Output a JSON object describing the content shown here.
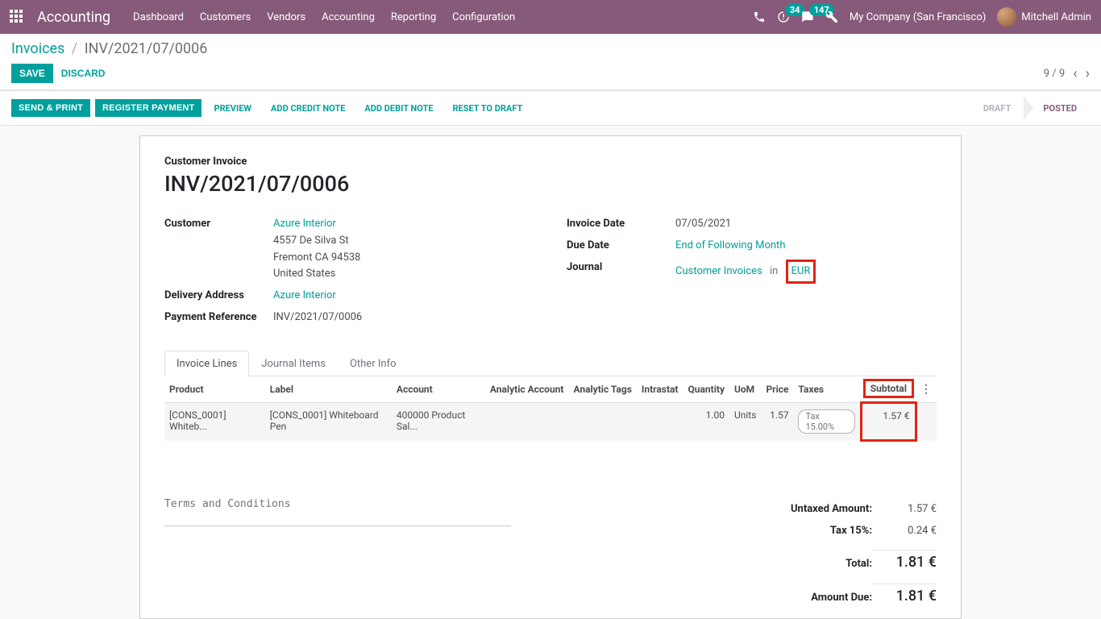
{
  "nav": {
    "brand": "Accounting",
    "menus": [
      "Dashboard",
      "Customers",
      "Vendors",
      "Accounting",
      "Reporting",
      "Configuration"
    ],
    "activity_count": "34",
    "message_count": "147",
    "company": "My Company (San Francisco)",
    "user": "Mitchell Admin"
  },
  "breadcrumb": {
    "root": "Invoices",
    "current": "INV/2021/07/0006"
  },
  "crumb_actions": {
    "save": "SAVE",
    "discard": "DISCARD",
    "pager": "9 / 9"
  },
  "actionbar": {
    "buttons": [
      "SEND & PRINT",
      "REGISTER PAYMENT"
    ],
    "links": [
      "PREVIEW",
      "ADD CREDIT NOTE",
      "ADD DEBIT NOTE",
      "RESET TO DRAFT"
    ],
    "statuses": [
      "DRAFT",
      "POSTED"
    ]
  },
  "invoice": {
    "subtitle": "Customer Invoice",
    "number": "INV/2021/07/0006",
    "labels": {
      "customer": "Customer",
      "delivery_address": "Delivery Address",
      "payment_reference": "Payment Reference",
      "invoice_date": "Invoice Date",
      "due_date": "Due Date",
      "journal": "Journal",
      "in": "in"
    },
    "customer_name": "Azure Interior",
    "customer_addr1": "4557 De Silva St",
    "customer_addr2": "Fremont CA 94538",
    "customer_addr3": "United States",
    "delivery_address": "Azure Interior",
    "payment_reference": "INV/2021/07/0006",
    "invoice_date": "07/05/2021",
    "due_date": "End of Following Month",
    "journal": "Customer Invoices",
    "currency": "EUR"
  },
  "tabs": [
    "Invoice Lines",
    "Journal Items",
    "Other Info"
  ],
  "table": {
    "headers": {
      "product": "Product",
      "label": "Label",
      "account": "Account",
      "analytic_account": "Analytic Account",
      "analytic_tags": "Analytic Tags",
      "intrastat": "Intrastat",
      "quantity": "Quantity",
      "uom": "UoM",
      "price": "Price",
      "taxes": "Taxes",
      "subtotal": "Subtotal"
    },
    "row": {
      "product": "[CONS_0001] Whiteb...",
      "label": "[CONS_0001] Whiteboard Pen",
      "account": "400000 Product Sal...",
      "quantity": "1.00",
      "uom": "Units",
      "price": "1.57",
      "tax": "Tax 15.00%",
      "subtotal": "1.57 €"
    }
  },
  "terms_placeholder": "Terms and Conditions",
  "totals": {
    "untaxed_label": "Untaxed Amount:",
    "untaxed_val": "1.57 €",
    "tax_label": "Tax 15%:",
    "tax_val": "0.24 €",
    "total_label": "Total:",
    "total_val": "1.81 €",
    "due_label": "Amount Due:",
    "due_val": "1.81 €"
  }
}
